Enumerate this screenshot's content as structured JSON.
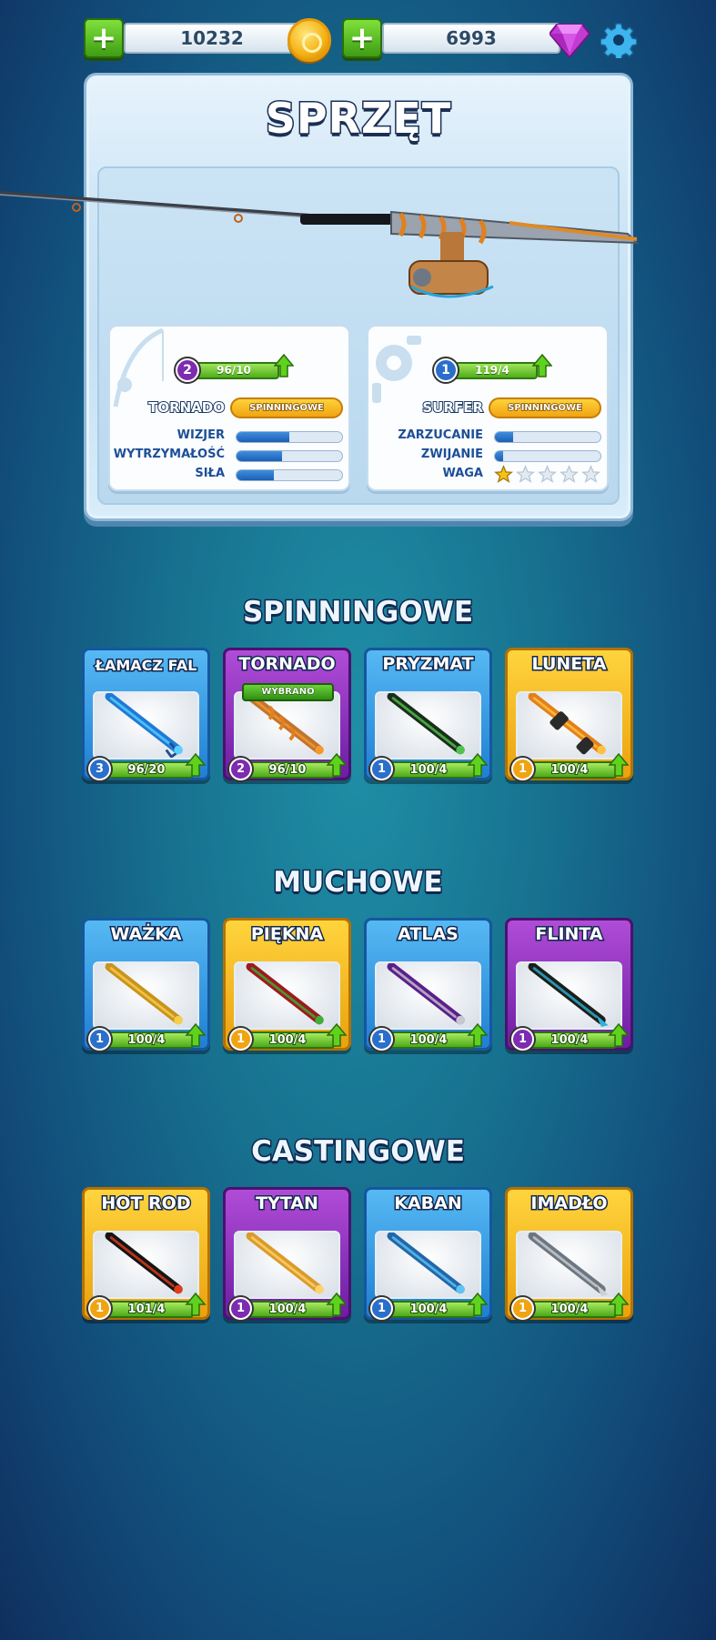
{
  "currency": {
    "coins": "10232",
    "gems": "6993",
    "coin_icon": "coin-icon",
    "gem_icon": "gem-icon",
    "settings_icon": "gear-icon"
  },
  "panel": {
    "title": "SPRZĘT",
    "rod": {
      "level": "2",
      "progress": "96/10",
      "name": "TORNADO",
      "type": "SPINNINGOWE",
      "stats": [
        {
          "label": "WIZJER",
          "value": 0.5
        },
        {
          "label": "WYTRZYMAŁOŚĆ",
          "value": 0.43
        },
        {
          "label": "SIŁA",
          "value": 0.35
        }
      ]
    },
    "reel": {
      "level": "1",
      "progress": "119/4",
      "name": "SURFER",
      "type": "SPINNINGOWE",
      "stats": [
        {
          "label": "ZARZUCANIE",
          "value": 0.17
        },
        {
          "label": "ZWIJANIE",
          "value": 0.08
        }
      ],
      "weight_label": "WAGA",
      "weight_stars": 1,
      "weight_stars_max": 5
    }
  },
  "sections": [
    {
      "title": "SPINNINGOWE",
      "cards": [
        {
          "name": "ŁAMACZ FAL",
          "color": "blue",
          "level": "3",
          "progress": "96/20",
          "selected": false
        },
        {
          "name": "TORNADO",
          "color": "purple",
          "level": "2",
          "progress": "96/10",
          "selected": true,
          "selected_label": "WYBRANO"
        },
        {
          "name": "PRYZMAT",
          "color": "blue",
          "level": "1",
          "progress": "100/4",
          "selected": false
        },
        {
          "name": "LUNETA",
          "color": "gold",
          "level": "1",
          "progress": "100/4",
          "selected": false
        }
      ]
    },
    {
      "title": "MUCHOWE",
      "cards": [
        {
          "name": "WAŻKA",
          "color": "blue",
          "level": "1",
          "progress": "100/4",
          "selected": false
        },
        {
          "name": "PIĘKNA",
          "color": "gold",
          "level": "1",
          "progress": "100/4",
          "selected": false
        },
        {
          "name": "ATLAS",
          "color": "blue",
          "level": "1",
          "progress": "100/4",
          "selected": false
        },
        {
          "name": "FLINTA",
          "color": "purple",
          "level": "1",
          "progress": "100/4",
          "selected": false
        }
      ]
    },
    {
      "title": "CASTINGOWE",
      "cards": [
        {
          "name": "HOT ROD",
          "color": "gold",
          "level": "1",
          "progress": "101/4",
          "selected": false
        },
        {
          "name": "TYTAN",
          "color": "purple",
          "level": "1",
          "progress": "100/4",
          "selected": false
        },
        {
          "name": "KABAN",
          "color": "blue",
          "level": "1",
          "progress": "100/4",
          "selected": false
        },
        {
          "name": "IMADŁO",
          "color": "gold",
          "level": "1",
          "progress": "100/4",
          "selected": false
        }
      ]
    }
  ],
  "colors": {
    "blue_card": "#1f7fd3",
    "purple_card": "#6d1da2",
    "gold_card": "#eaa10e",
    "level_green": "#4caa19"
  }
}
